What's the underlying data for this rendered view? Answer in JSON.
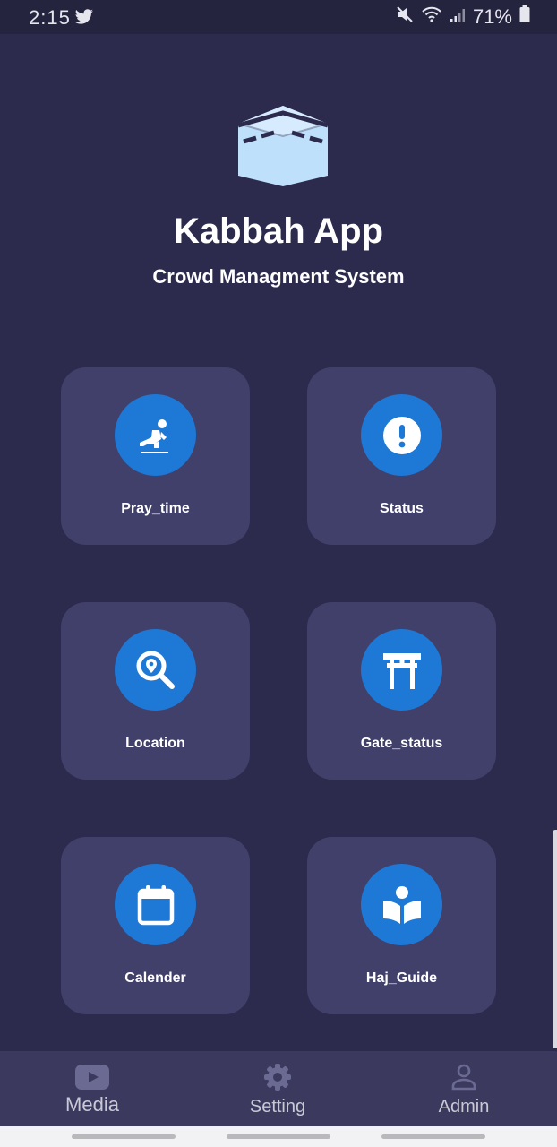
{
  "status_bar": {
    "time": "2:15",
    "battery": "71%",
    "icons": [
      "twitter-icon",
      "mute-icon",
      "wifi-icon",
      "signal-icon",
      "battery-icon"
    ]
  },
  "header": {
    "logo_icon": "kaaba-icon",
    "title": "Kabbah App",
    "subtitle": "Crowd Managment System"
  },
  "tiles": [
    {
      "label": "Pray_time",
      "icon": "praying-person-icon"
    },
    {
      "label": "Status",
      "icon": "exclamation-icon"
    },
    {
      "label": "Location",
      "icon": "location-search-icon"
    },
    {
      "label": "Gate_status",
      "icon": "torii-gate-icon"
    },
    {
      "label": "Calender",
      "icon": "calendar-icon"
    },
    {
      "label": "Haj_Guide",
      "icon": "reading-book-icon"
    }
  ],
  "bottom_nav": {
    "items": [
      {
        "label": "Media",
        "icon": "video-play-icon"
      },
      {
        "label": "Setting",
        "icon": "gear-icon"
      },
      {
        "label": "Admin",
        "icon": "person-icon"
      }
    ]
  },
  "colors": {
    "background": "#2c2b4d",
    "tile": "#41406a",
    "accent": "#1e78d6",
    "nav_bar": "#3b3a5e"
  }
}
